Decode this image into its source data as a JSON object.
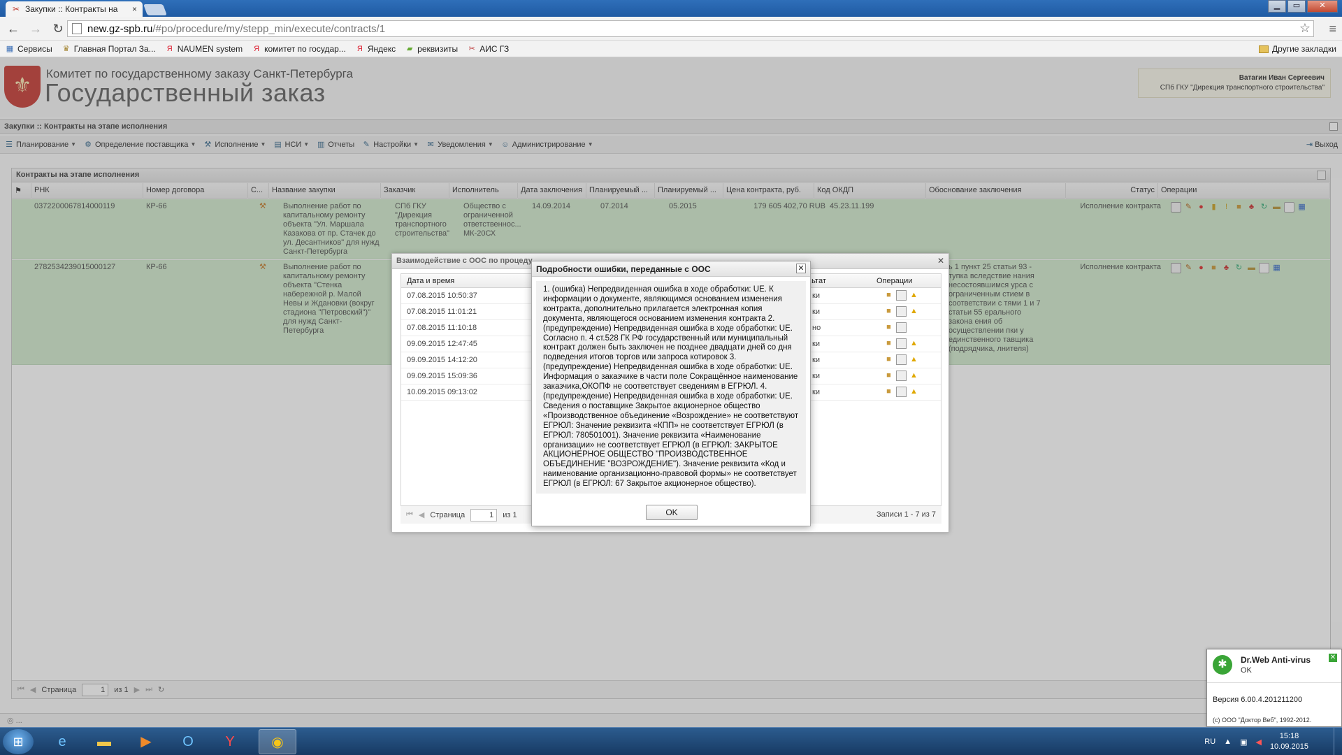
{
  "browser": {
    "tab_title": "Закупки :: Контракты на",
    "tab_close": "×",
    "url_host": "new.gz-spb.ru",
    "url_path": "/#po/procedure/my/stepp_min/execute/contracts/1",
    "window_controls": [
      "▁",
      "▭",
      "✕"
    ],
    "bookmarks": [
      {
        "label": "Сервисы",
        "icon": "apps-icon"
      },
      {
        "label": "Главная Портал За...",
        "icon": "crest-icon"
      },
      {
        "label": "NAUMEN system",
        "icon": "yandex-icon"
      },
      {
        "label": "комитет по государ...",
        "icon": "yandex-icon"
      },
      {
        "label": "Яндекс",
        "icon": "yandex-icon"
      },
      {
        "label": "реквизиты",
        "icon": "doc-icon"
      },
      {
        "label": "АИС ГЗ",
        "icon": "tool-icon"
      }
    ],
    "other_bookmarks": "Другие закладки"
  },
  "app": {
    "org_name": "Комитет по государственному заказу Санкт-Петербурга",
    "brand": "Государственный заказ",
    "user_name": "Ватагин Иван Сергеевич",
    "user_org": "СПб ГКУ \"Дирекция транспортного строительства\"",
    "breadcrumb": "Закупки :: Контракты на этапе исполнения",
    "menu": [
      {
        "label": "Планирование",
        "icon": "plan-icon"
      },
      {
        "label": "Определение поставщика",
        "icon": "supplier-icon"
      },
      {
        "label": "Исполнение",
        "icon": "execution-icon"
      },
      {
        "label": "НСИ",
        "icon": "catalog-icon"
      },
      {
        "label": "Отчеты",
        "icon": "report-icon"
      },
      {
        "label": "Настройки",
        "icon": "settings-icon"
      },
      {
        "label": "Уведомления",
        "icon": "notification-icon"
      },
      {
        "label": "Администрирование",
        "icon": "admin-icon"
      }
    ],
    "exit_label": "Выход",
    "status_line": "◎ ...",
    "colors": {
      "row_highlight": "#d3ebcf",
      "brand_red": "#c8403a"
    }
  },
  "grid": {
    "title": "Контракты на этапе исполнения",
    "columns": [
      "РНК",
      "Номер договора",
      "С...",
      "Название закупки",
      "Заказчик",
      "Исполнитель",
      "Дата заключения",
      "Планируемый ...",
      "Планируемый ...",
      "Цена контракта, руб.",
      "Код ОКДП",
      "Обоснование заключения",
      "Статус",
      "Операции"
    ],
    "rows": [
      {
        "rnk": "0372200067814000119",
        "contract_no": "КР-66",
        "name": "Выполнение работ по капитальному ремонту объекта \"Ул. Маршала Казакова от пр. Стачек до ул. Десантников\" для нужд Санкт-Петербурга",
        "customer": "СПб ГКУ \"Дирекция транспортного строительства\"",
        "executor": "Общество с ограниченной ответственнос... МК-20СХ",
        "date_signed": "14.09.2014",
        "planned1": "07.2014",
        "planned2": "05.2015",
        "price": "179 605 402,70 RUB",
        "okdp": "45.23.11.199",
        "reason": "",
        "status": "Исполнение контракта"
      },
      {
        "rnk": "2782534239015000127",
        "contract_no": "КР-66",
        "name": "Выполнение работ по капитальному ремонту объекта \"Стенка набережной р. Малой Невы и Ждановки (вокруг стадиона \"Петровский\")\" для нужд Санкт-Петербурга",
        "customer": "",
        "executor": "",
        "date_signed": "",
        "planned1": "",
        "planned2": "",
        "price": "",
        "okdp": "",
        "reason": "ь 1 пункт 25 статьи 93 - тупка вследствие нания несостоявшимся урса с ограниченным стием в соответствии с тями 1 и 7 статьи 55 ерального закона ения об осуществлении пки у единственного тавщика (подрядчика, лнителя)",
        "status": "Исполнение контракта"
      }
    ],
    "pager": {
      "page_label": "Страница",
      "page": "1",
      "of_label": "из 1"
    }
  },
  "oos_window": {
    "title": "Взаимодействие с ООС по процеду...",
    "col_datetime": "Дата и время",
    "col_result": "...ьтат",
    "col_ops": "Операции",
    "rows": [
      {
        "dt": "07.08.2015 10:50:37",
        "res": "ки",
        "warn": true
      },
      {
        "dt": "07.08.2015 11:01:21",
        "res": "ки",
        "warn": true
      },
      {
        "dt": "07.08.2015 11:10:18",
        "res": "но",
        "warn": false
      },
      {
        "dt": "09.09.2015 12:47:45",
        "res": "ки",
        "warn": true
      },
      {
        "dt": "09.09.2015 14:12:20",
        "res": "ки",
        "warn": true
      },
      {
        "dt": "09.09.2015 15:09:36",
        "res": "ки",
        "warn": true
      },
      {
        "dt": "10.09.2015 09:13:02",
        "res": "ки",
        "warn": true
      }
    ],
    "page_label": "Страница",
    "page": "1",
    "of_label": "из 1",
    "records": "Записи 1 - 7 из 7"
  },
  "error_dialog": {
    "title": "Подробности ошибки, переданные с ООС",
    "body": "1. (ошибка) Непредвиденная ошибка в ходе обработки: UE. К информации о документе, являющимся основанием изменения контракта, дополнительно прилагается электронная копия документа, являющегося основанием изменения контракта 2. (предупреждение) Непредвиденная ошибка в ходе обработки: UE. Согласно п. 4 ст.528 ГК РФ государственный или муниципальный контракт должен быть заключен не позднее двадцати дней со дня подведения итогов торгов или запроса котировок 3. (предупреждение) Непредвиденная ошибка в ходе обработки: UE. Информация о заказчике в части поле Сокращённое наименование заказчика,ОКОПФ не соответствует сведениям в ЕГРЮЛ. 4. (предупреждение) Непредвиденная ошибка в ходе обработки: UE. Сведения о поставщике Закрытое акционерное общество «Производственное объединение «Возрождение» не соответствуют ЕГРЮЛ: Значение реквизита «КПП» не соответствует ЕГРЮЛ (в ЕГРЮЛ: 780501001). Значение реквизита «Наименование организации» не соответствует ЕГРЮЛ (в ЕГРЮЛ: ЗАКРЫТОЕ АКЦИОНЕРНОЕ ОБЩЕСТВО \"ПРОИЗВОДСТВЕННОЕ ОБЪЕДИНЕНИЕ \"ВОЗРОЖДЕНИЕ\"). Значение реквизита «Код и наименование организационно-правовой формы» не соответствует ЕГРЮЛ (в ЕГРЮЛ: 67 Закрытое акционерное общество).",
    "ok_label": "OK"
  },
  "drweb": {
    "name": "Dr.Web Anti-virus",
    "status": "OK",
    "version": "Версия 6.00.4.201211200",
    "copyright": "(c) ООО \"Доктор Веб\", 1992-2012."
  },
  "taskbar": {
    "lang": "RU",
    "time": "15:18",
    "date": "10.09.2015",
    "apps": [
      "windows-start-icon",
      "ie-icon",
      "explorer-icon",
      "media-player-icon",
      "outlook-icon",
      "yandex-browser-icon",
      "chrome-icon"
    ]
  }
}
